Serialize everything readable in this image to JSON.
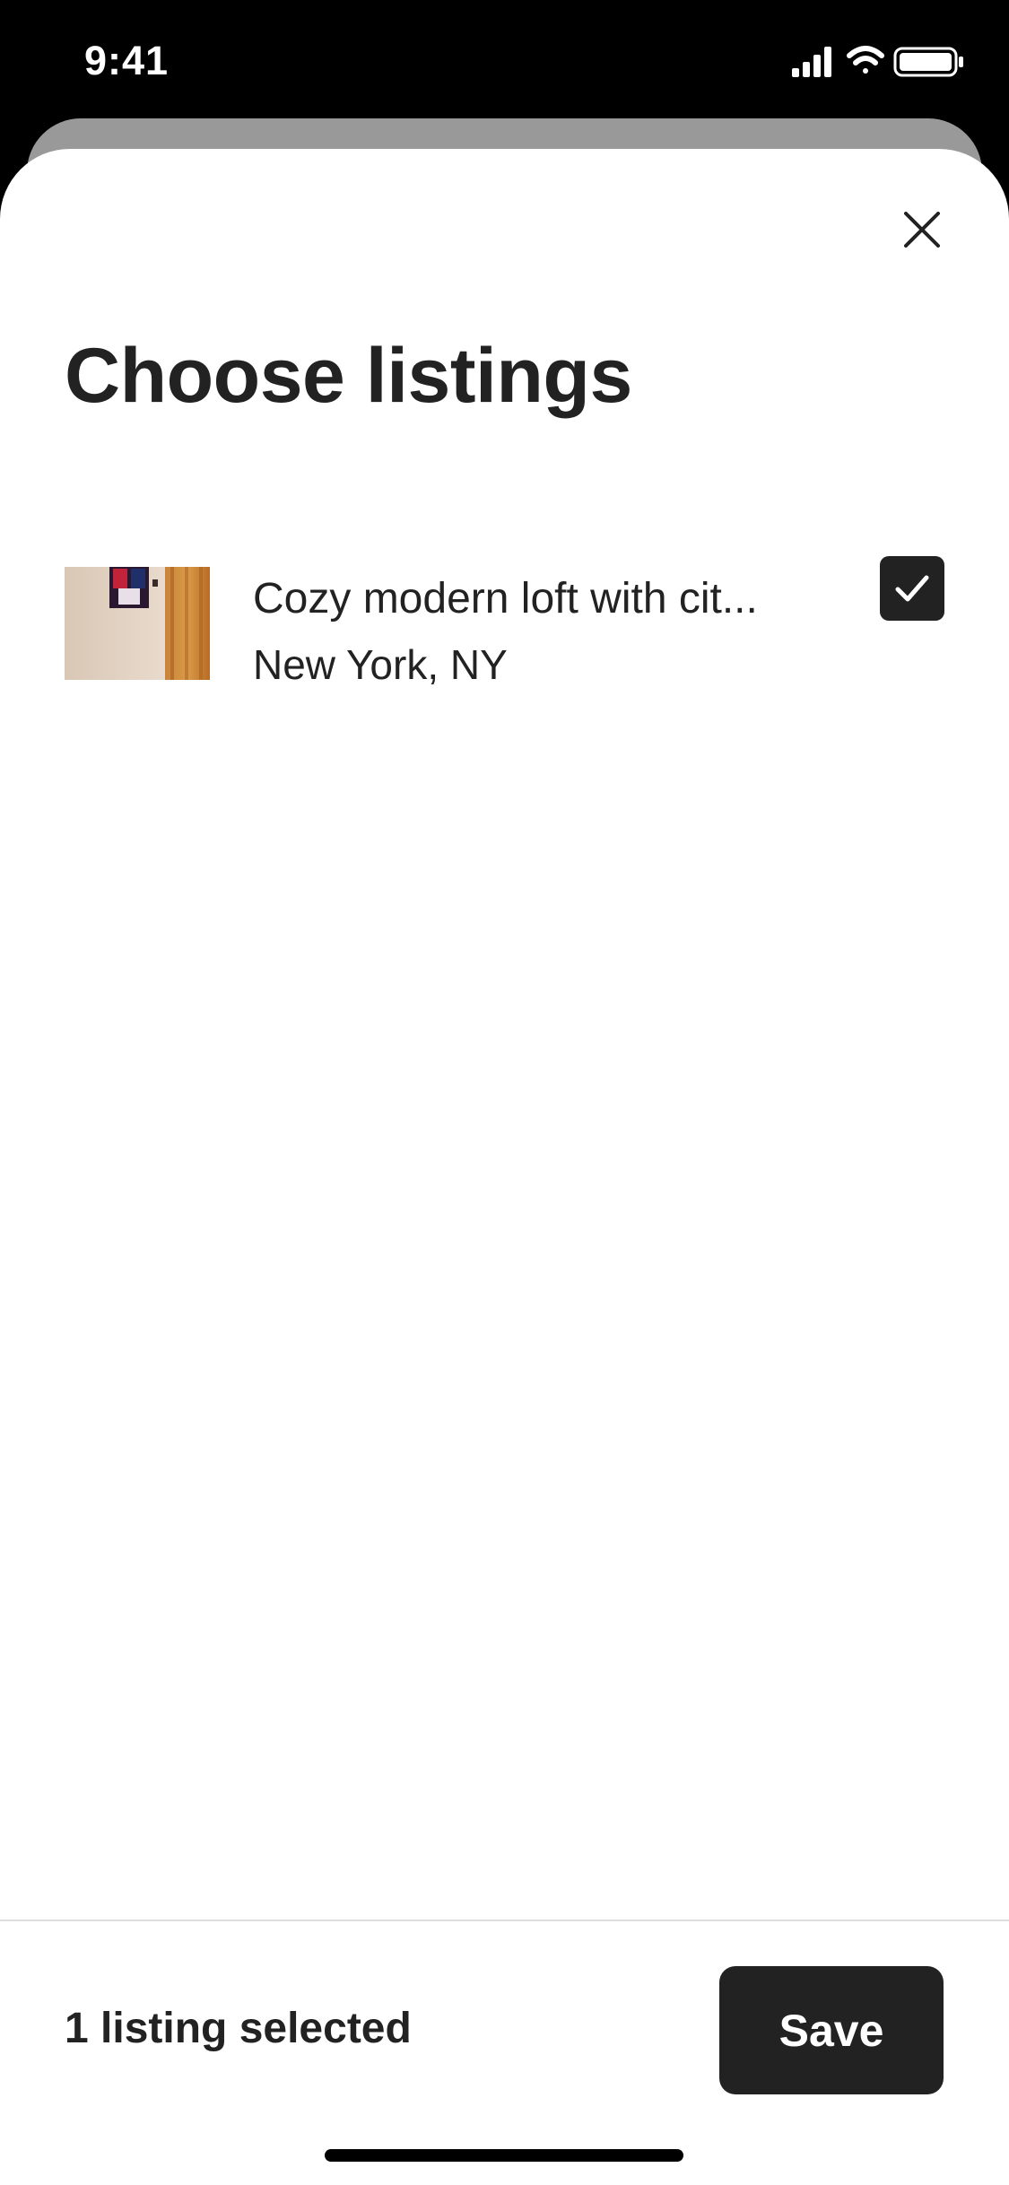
{
  "status_bar": {
    "time": "9:41",
    "icons": [
      "signal-icon",
      "wifi-icon",
      "battery-icon"
    ]
  },
  "header": {
    "close_icon": "close-icon",
    "title": "Choose listings"
  },
  "listings": [
    {
      "title": "Cozy modern loft with cit...",
      "location": "New York, NY",
      "selected": true
    }
  ],
  "footer": {
    "selected_text": "1 listing selected",
    "save_label": "Save"
  },
  "colors": {
    "primary": "#222222",
    "background": "#ffffff",
    "divider": "#dddddd",
    "back_sheet": "#999999"
  }
}
